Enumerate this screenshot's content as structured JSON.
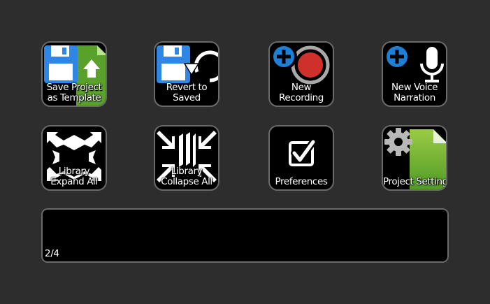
{
  "colors": {
    "background": "#2d2d2d",
    "key_background": "#000000",
    "key_border": "#6a6a6a",
    "floppy_blue": "#2f86e4",
    "doc_green": "#5aa12c",
    "record_red": "#d0302b",
    "plus_blue": "#1e7fd6"
  },
  "keys": [
    {
      "icon": "save-template-icon",
      "line1": "Save Project",
      "line2": "as Template"
    },
    {
      "icon": "revert-icon",
      "line1": "Revert to",
      "line2": "Saved"
    },
    {
      "icon": "new-recording-icon",
      "line1": "New",
      "line2": "Recording"
    },
    {
      "icon": "new-voice-narration-icon",
      "line1": "New Voice",
      "line2": "Narration"
    },
    {
      "icon": "expand-all-icon",
      "line1": "Library",
      "line2": "Expand All"
    },
    {
      "icon": "collapse-all-icon",
      "line1": "Library",
      "line2": "Collapse All"
    },
    {
      "icon": "preferences-checkbox-icon",
      "line1": "",
      "line2": "Preferences"
    },
    {
      "icon": "project-settings-icon",
      "line1": "",
      "line2": "Project Settings"
    }
  ],
  "display": {
    "page_indicator": "2/4"
  }
}
